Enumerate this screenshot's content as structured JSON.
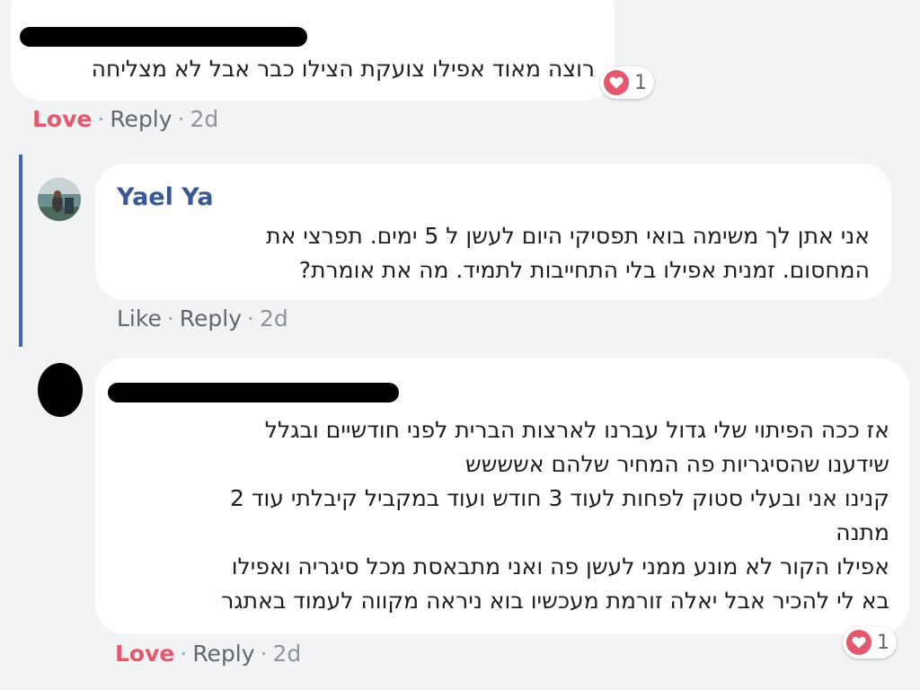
{
  "comments": [
    {
      "author_redacted": true,
      "text": "רוצה מאוד אפילו צועקת הצילו כבר אבל לא מצליחה",
      "actions": {
        "react_label": "Love",
        "reply_label": "Reply",
        "time": "2d"
      },
      "reaction": {
        "icon": "heart-icon",
        "count": "1"
      }
    },
    {
      "author": "Yael Ya",
      "avatar": "photo-avatar",
      "text": "אני אתן לך משימה בואי תפסיקי היום לעשן ל 5 ימים. תפרצי את\nהמחסום. זמנית אפילו בלי התחייבות לתמיד. מה את אומרת?",
      "actions": {
        "react_label": "Like",
        "reply_label": "Reply",
        "time": "2d"
      }
    },
    {
      "author_redacted": true,
      "avatar": "redacted-avatar",
      "text": "אז ככה הפיתוי שלי גדול עברנו לארצות הברית לפני חודשיים ובגלל\nשידענו שהסיגריות פה המחיר שלהם אשששש\nקנינו אני ובעלי סטוק לפחות לעוד 3 חודש ועוד במקביל קיבלתי עוד 2\nמתנה\nאפילו הקור לא מונע ממני לעשן פה ואני מתבאסת מכל סיגריה ואפילו\nבא לי להכיר אבל יאלה זורמת מעכשיו בוא ניראה מקווה לעמוד באתגר",
      "actions": {
        "react_label": "Love",
        "reply_label": "Reply",
        "time": "2d"
      },
      "reaction": {
        "icon": "heart-icon",
        "count": "1"
      }
    }
  ],
  "colors": {
    "background": "#f2f3f5",
    "bubble": "#ffffff",
    "name": "#385898",
    "love": "#e4586d",
    "thread_line": "#4267b2"
  }
}
